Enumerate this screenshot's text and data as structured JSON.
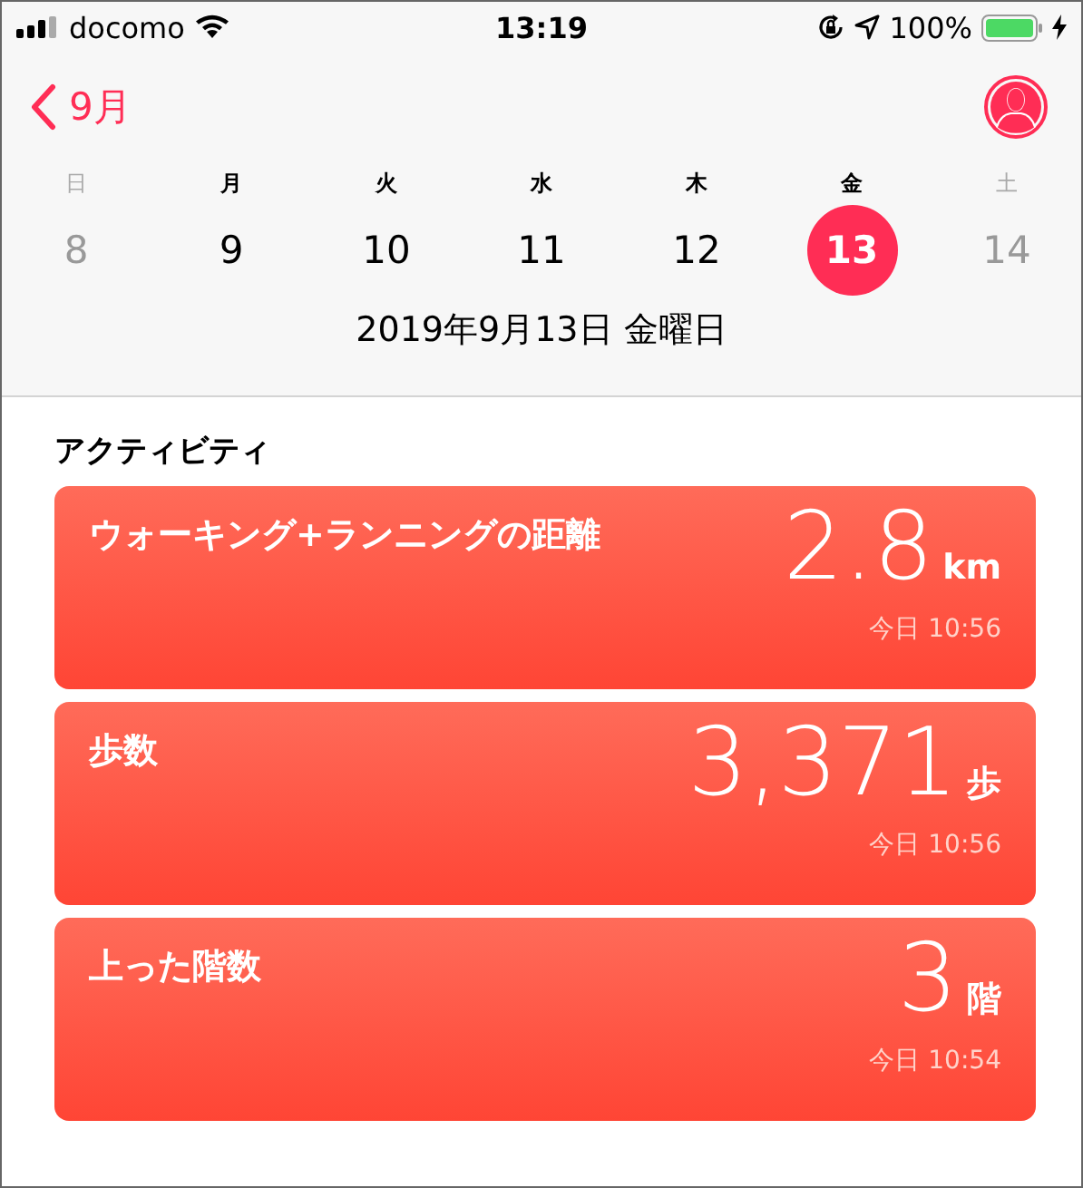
{
  "status_bar": {
    "carrier": "docomo",
    "time": "13:19",
    "battery": "100%"
  },
  "nav": {
    "back_label": "9月"
  },
  "week": [
    {
      "weekday": "日",
      "day": "8",
      "weekend": true,
      "selected": false
    },
    {
      "weekday": "月",
      "day": "9",
      "weekend": false,
      "selected": false
    },
    {
      "weekday": "火",
      "day": "10",
      "weekend": false,
      "selected": false
    },
    {
      "weekday": "水",
      "day": "11",
      "weekend": false,
      "selected": false
    },
    {
      "weekday": "木",
      "day": "12",
      "weekend": false,
      "selected": false
    },
    {
      "weekday": "金",
      "day": "13",
      "weekend": false,
      "selected": true
    },
    {
      "weekday": "土",
      "day": "14",
      "weekend": true,
      "selected": false
    }
  ],
  "date_title": "2019年9月13日 金曜日",
  "section_title": "アクティビティ",
  "cards": [
    {
      "title": "ウォーキング+ランニングの距離",
      "value": "2.8",
      "unit": "km",
      "time": "今日 10:56"
    },
    {
      "title": "歩数",
      "value": "3,371",
      "unit": "歩",
      "time": "今日 10:56"
    },
    {
      "title": "上った階数",
      "value": "3",
      "unit": "階",
      "time": "今日 10:54"
    }
  ]
}
